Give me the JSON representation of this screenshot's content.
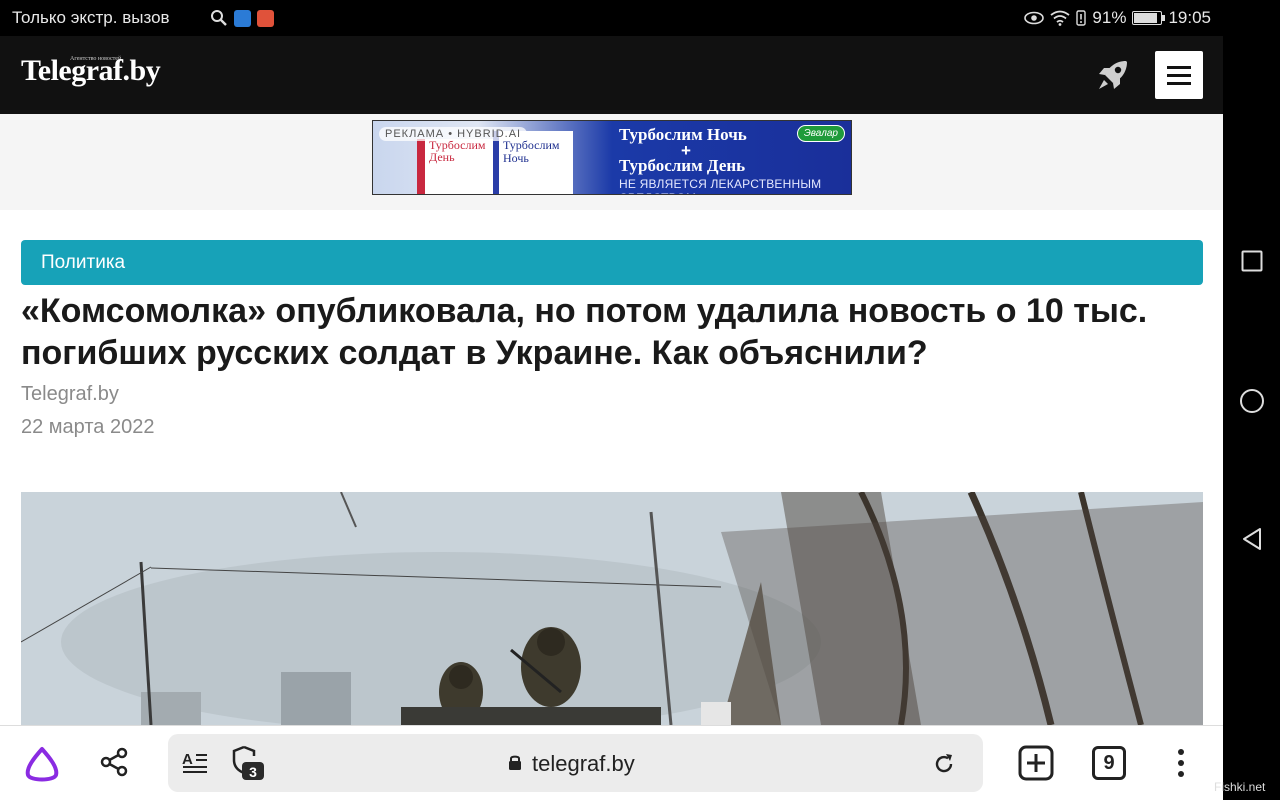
{
  "status_bar": {
    "carrier": "Только экстр. вызов",
    "battery_percent": "91%",
    "battery_level": 0.91,
    "time": "19:05",
    "icons": [
      "search-icon",
      "shield-app-icon",
      "mail-app-icon",
      "eye-icon",
      "wifi-icon",
      "alert-icon",
      "battery-icon"
    ]
  },
  "site_header": {
    "logo": "Telegraf.by",
    "logo_sub": "Агентство новостей",
    "icons": [
      "rocket-icon",
      "menu-icon"
    ]
  },
  "ad": {
    "label": "РЕКЛАМА • HYBRID.AI",
    "pack1": "Турбослим День",
    "pack2": "Турбослим Ночь",
    "line1": "Турбослим Ночь",
    "plus": "+",
    "line2": "Турбослим День",
    "disclaimer": "НЕ ЯВЛЯЕТСЯ ЛЕКАРСТВЕННЫМ СРЕДСТВОМ",
    "brand": "Эвалар"
  },
  "article": {
    "category": "Политика",
    "title": "«Комсомолка» опубликовала, но потом удалила новость о 10 тыс. погибших русских солдат в Украине. Как объяснили?",
    "source": "Telegraf.by",
    "date": "22 марта 2022"
  },
  "browser_bar": {
    "url": "telegraf.by",
    "protect_badge": "3",
    "tabs_count": "9",
    "icons": [
      "alice-icon",
      "share-icon",
      "reader-mode-icon",
      "protect-icon",
      "lock-icon",
      "reload-icon",
      "new-tab-icon",
      "tabs-icon",
      "more-icon"
    ]
  },
  "nav_bar": {
    "icons": [
      "recent-apps-icon",
      "home-icon",
      "back-icon"
    ]
  },
  "watermark": "Fishki.net",
  "colors": {
    "accent": "#17a2b8",
    "header_bg": "#111111",
    "alice": "#8a2be2"
  }
}
